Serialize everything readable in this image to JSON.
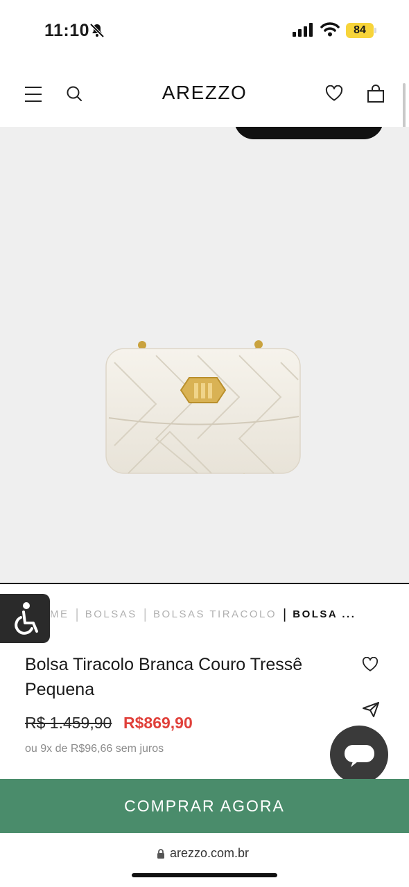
{
  "status_bar": {
    "time": "11:10",
    "battery": "84"
  },
  "header": {
    "logo": "AREZZO"
  },
  "breadcrumb": {
    "items": [
      "ME",
      "BOLSAS",
      "BOLSAS TIRACOLO"
    ],
    "current": "BOLSA ..."
  },
  "product": {
    "title": "Bolsa Tiracolo Branca Couro Tressê Pequena",
    "price_old": "R$ 1.459,90",
    "price_new": "R$869,90",
    "installments": "ou 9x de R$96,66 sem juros"
  },
  "cta": {
    "buy_label": "COMPRAR AGORA"
  },
  "browser": {
    "url": "arezzo.com.br"
  },
  "colors": {
    "buy_button": "#4a8c6b",
    "sale_price": "#e0403a",
    "battery": "#f7d43a"
  }
}
